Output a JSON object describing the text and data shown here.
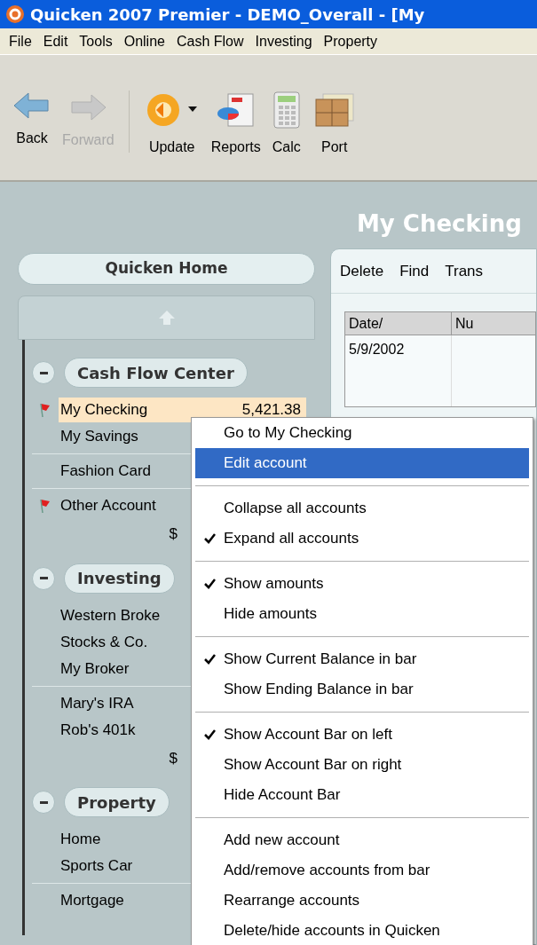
{
  "window": {
    "title": "Quicken 2007 Premier - DEMO_Overall - [My"
  },
  "menu_bar": [
    "File",
    "Edit",
    "Tools",
    "Online",
    "Cash Flow",
    "Investing",
    "Property"
  ],
  "toolbar": [
    {
      "label": "Back",
      "kind": "back",
      "disabled": false
    },
    {
      "label": "Forward",
      "kind": "forward",
      "disabled": true
    },
    {
      "label": "Update",
      "kind": "update",
      "disabled": false
    },
    {
      "label": "Reports",
      "kind": "reports",
      "disabled": false
    },
    {
      "label": "Calc",
      "kind": "calc",
      "disabled": false
    },
    {
      "label": "Port",
      "kind": "port",
      "disabled": false
    }
  ],
  "sidebar": {
    "home_button": "Quicken Home",
    "groups": [
      {
        "title": "Cash Flow Center",
        "expanded": true,
        "sections": [
          [
            {
              "name": "My Checking",
              "amount": "5,421.38",
              "flagged": true,
              "selected": true
            },
            {
              "name": "My Savings",
              "flagged": false,
              "selected": false
            }
          ],
          [
            {
              "name": "Fashion Card",
              "flagged": false,
              "selected": false
            }
          ],
          [
            {
              "name": "Other Account",
              "flagged": true,
              "selected": false
            }
          ]
        ],
        "total": "$"
      },
      {
        "title": "Investing",
        "expanded": true,
        "sections": [
          [
            {
              "name": "Western Broke",
              "flagged": false,
              "selected": false
            },
            {
              "name": "Stocks & Co.",
              "flagged": false,
              "selected": false
            },
            {
              "name": "My Broker",
              "flagged": false,
              "selected": false
            }
          ],
          [
            {
              "name": "Mary's IRA",
              "flagged": false,
              "selected": false
            },
            {
              "name": "Rob's 401k",
              "flagged": false,
              "selected": false
            }
          ]
        ],
        "total": "$"
      },
      {
        "title": "Property",
        "expanded": true,
        "sections": [
          [
            {
              "name": "Home",
              "flagged": false,
              "selected": false
            },
            {
              "name": "Sports Car",
              "flagged": false,
              "selected": false
            }
          ],
          [
            {
              "name": "Mortgage",
              "flagged": false,
              "selected": false
            }
          ]
        ]
      }
    ]
  },
  "register": {
    "title": "My Checking",
    "actions": [
      "Delete",
      "Find",
      "Trans"
    ],
    "columns": [
      "Date/",
      "Nu"
    ],
    "rows": [
      [
        "5/9/2002",
        ""
      ]
    ]
  },
  "context_menu": {
    "groups": [
      [
        {
          "label": "Go to My Checking",
          "checked": false,
          "selected": false
        },
        {
          "label": "Edit account",
          "checked": false,
          "selected": true
        }
      ],
      [
        {
          "label": "Collapse all accounts",
          "checked": false,
          "selected": false
        },
        {
          "label": "Expand all accounts",
          "checked": true,
          "selected": false
        }
      ],
      [
        {
          "label": "Show amounts",
          "checked": true,
          "selected": false
        },
        {
          "label": "Hide amounts",
          "checked": false,
          "selected": false
        }
      ],
      [
        {
          "label": "Show Current Balance in bar",
          "checked": true,
          "selected": false
        },
        {
          "label": "Show Ending Balance in bar",
          "checked": false,
          "selected": false
        }
      ],
      [
        {
          "label": "Show Account Bar on left",
          "checked": true,
          "selected": false
        },
        {
          "label": "Show Account Bar on right",
          "checked": false,
          "selected": false
        },
        {
          "label": "Hide Account Bar",
          "checked": false,
          "selected": false
        }
      ],
      [
        {
          "label": "Add new account",
          "checked": false,
          "selected": false
        },
        {
          "label": "Add/remove accounts from bar",
          "checked": false,
          "selected": false
        },
        {
          "label": "Rearrange accounts",
          "checked": false,
          "selected": false
        },
        {
          "label": "Delete/hide accounts in Quicken",
          "checked": false,
          "selected": false
        }
      ]
    ]
  }
}
